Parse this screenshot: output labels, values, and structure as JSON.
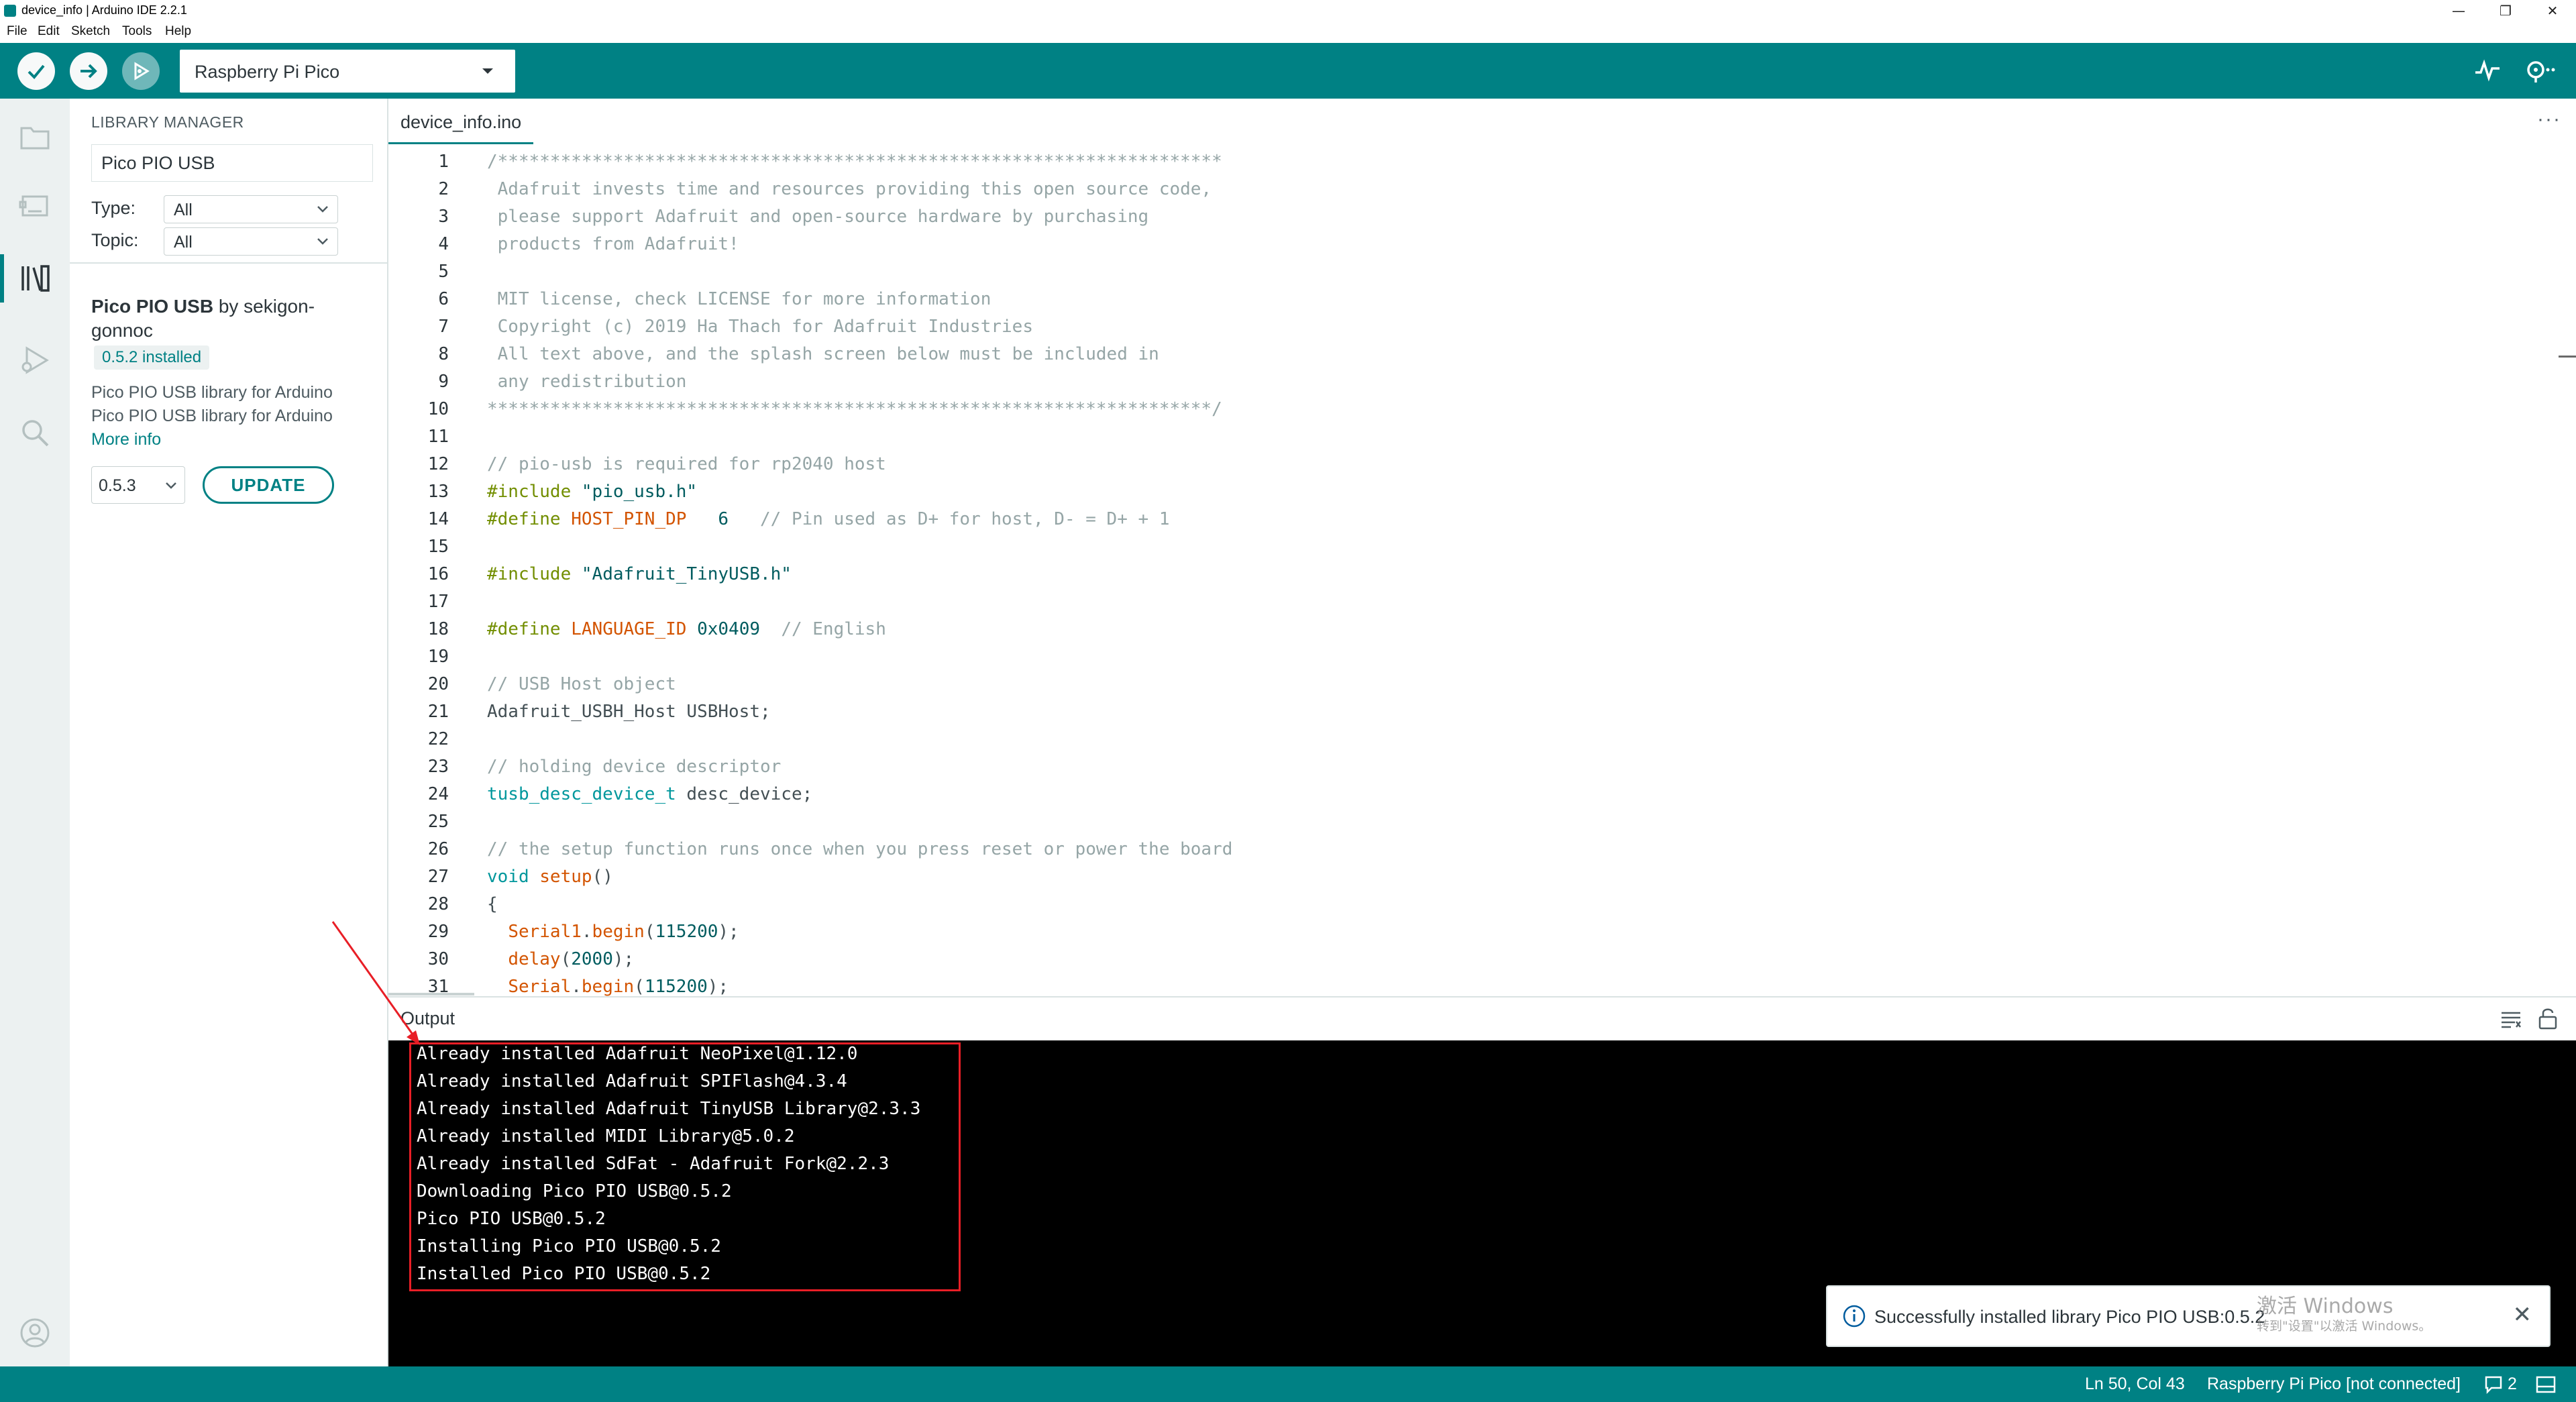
{
  "window": {
    "title": "device_info | Arduino IDE 2.2.1",
    "controls": [
      "—",
      "❐",
      "✕"
    ]
  },
  "menu": [
    "File",
    "Edit",
    "Sketch",
    "Tools",
    "Help"
  ],
  "toolbar": {
    "board": "Raspberry Pi Pico"
  },
  "sidebar": {
    "header": "LIBRARY MANAGER",
    "search_value": "Pico PIO USB",
    "type_label": "Type:",
    "type_value": "All",
    "topic_label": "Topic:",
    "topic_value": "All",
    "library": {
      "name": "Pico PIO USB",
      "by": " by sekigon-gonnoc",
      "installed_badge": "0.5.2 installed",
      "desc_line1": "Pico PIO USB library for Arduino",
      "desc_line2": "Pico PIO USB library for Arduino",
      "more_info": "More info",
      "version": "0.5.3",
      "update_label": "UPDATE"
    }
  },
  "editor": {
    "tab": "device_info.ino",
    "more": "···",
    "line_numbers": [
      "1",
      "2",
      "3",
      "4",
      "5",
      "6",
      "7",
      "8",
      "9",
      "10",
      "11",
      "12",
      "13",
      "14",
      "15",
      "16",
      "17",
      "18",
      "19",
      "20",
      "21",
      "22",
      "23",
      "24",
      "25",
      "26",
      "27",
      "28",
      "29",
      "30",
      "31"
    ],
    "lines": [
      [
        {
          "t": "/*********************************************************************",
          "c": "com"
        }
      ],
      [
        {
          "t": " Adafruit invests time and resources providing this open source code,",
          "c": "com"
        }
      ],
      [
        {
          "t": " please support Adafruit and open-source hardware by purchasing",
          "c": "com"
        }
      ],
      [
        {
          "t": " products from Adafruit!",
          "c": "com"
        }
      ],
      [
        {
          "t": "",
          "c": "com"
        }
      ],
      [
        {
          "t": " MIT license, check LICENSE for more information",
          "c": "com"
        }
      ],
      [
        {
          "t": " Copyright (c) 2019 Ha Thach for Adafruit Industries",
          "c": "com"
        }
      ],
      [
        {
          "t": " All text above, and the splash screen below must be included in",
          "c": "com"
        }
      ],
      [
        {
          "t": " any redistribution",
          "c": "com"
        }
      ],
      [
        {
          "t": "*********************************************************************/",
          "c": "com"
        }
      ],
      [
        {
          "t": "",
          "c": "plain"
        }
      ],
      [
        {
          "t": "// pio-usb is required for rp2040 host",
          "c": "com"
        }
      ],
      [
        {
          "t": "#include ",
          "c": "kw"
        },
        {
          "t": "\"pio_usb.h\"",
          "c": "str"
        }
      ],
      [
        {
          "t": "#define ",
          "c": "kw"
        },
        {
          "t": "HOST_PIN_DP",
          "c": "kw2"
        },
        {
          "t": "   6   ",
          "c": "str"
        },
        {
          "t": "// Pin used as D+ for host, D- = D+ + 1",
          "c": "com"
        }
      ],
      [
        {
          "t": "",
          "c": "plain"
        }
      ],
      [
        {
          "t": "#include ",
          "c": "kw"
        },
        {
          "t": "\"Adafruit_TinyUSB.h\"",
          "c": "str"
        }
      ],
      [
        {
          "t": "",
          "c": "plain"
        }
      ],
      [
        {
          "t": "#define ",
          "c": "kw"
        },
        {
          "t": "LANGUAGE_ID",
          "c": "kw2"
        },
        {
          "t": " 0x0409  ",
          "c": "str"
        },
        {
          "t": "// English",
          "c": "com"
        }
      ],
      [
        {
          "t": "",
          "c": "plain"
        }
      ],
      [
        {
          "t": "// USB Host object",
          "c": "com"
        }
      ],
      [
        {
          "t": "Adafruit_USBH_Host USBHost;",
          "c": "plain"
        }
      ],
      [
        {
          "t": "",
          "c": "plain"
        }
      ],
      [
        {
          "t": "// holding device descriptor",
          "c": "com"
        }
      ],
      [
        {
          "t": "tusb_desc_device_t",
          "c": "type"
        },
        {
          "t": " desc_device;",
          "c": "plain"
        }
      ],
      [
        {
          "t": "",
          "c": "plain"
        }
      ],
      [
        {
          "t": "// the setup function runs once when you press reset or power the board",
          "c": "com"
        }
      ],
      [
        {
          "t": "void ",
          "c": "type"
        },
        {
          "t": "setup",
          "c": "fn"
        },
        {
          "t": "()",
          "c": "plain"
        }
      ],
      [
        {
          "t": "{",
          "c": "plain"
        }
      ],
      [
        {
          "t": "  ",
          "c": "plain"
        },
        {
          "t": "Serial1",
          "c": "fn"
        },
        {
          "t": ".",
          "c": "plain"
        },
        {
          "t": "begin",
          "c": "fn"
        },
        {
          "t": "(",
          "c": "plain"
        },
        {
          "t": "115200",
          "c": "str"
        },
        {
          "t": ");",
          "c": "plain"
        }
      ],
      [
        {
          "t": "  ",
          "c": "plain"
        },
        {
          "t": "delay",
          "c": "fn"
        },
        {
          "t": "(",
          "c": "plain"
        },
        {
          "t": "2000",
          "c": "str"
        },
        {
          "t": ");",
          "c": "plain"
        }
      ],
      [
        {
          "t": "  ",
          "c": "plain"
        },
        {
          "t": "Serial",
          "c": "fn"
        },
        {
          "t": ".",
          "c": "plain"
        },
        {
          "t": "begin",
          "c": "fn"
        },
        {
          "t": "(",
          "c": "plain"
        },
        {
          "t": "115200",
          "c": "str"
        },
        {
          "t": ");",
          "c": "plain"
        }
      ]
    ]
  },
  "output": {
    "title": "Output",
    "lines": [
      "Already installed Adafruit NeoPixel@1.12.0",
      "Already installed Adafruit SPIFlash@4.3.4",
      "Already installed Adafruit TinyUSB Library@2.3.3",
      "Already installed MIDI Library@5.0.2",
      "Already installed SdFat - Adafruit Fork@2.2.3",
      "Downloading Pico PIO USB@0.5.2",
      "Pico PIO USB@0.5.2",
      "Installing Pico PIO USB@0.5.2",
      "Installed Pico PIO USB@0.5.2"
    ]
  },
  "notification": {
    "message": "Successfully installed library Pico PIO USB:0.5.2",
    "watermark_title": "激活 Windows",
    "watermark_sub": "转到\"设置\"以激活 Windows。"
  },
  "statusbar": {
    "position": "Ln 50, Col 43",
    "board_status": "Raspberry Pi Pico [not connected]",
    "notifications": "2"
  },
  "colors": {
    "accent": "#008184",
    "highlight_box": "#e81e26",
    "output_bg": "#000000"
  }
}
